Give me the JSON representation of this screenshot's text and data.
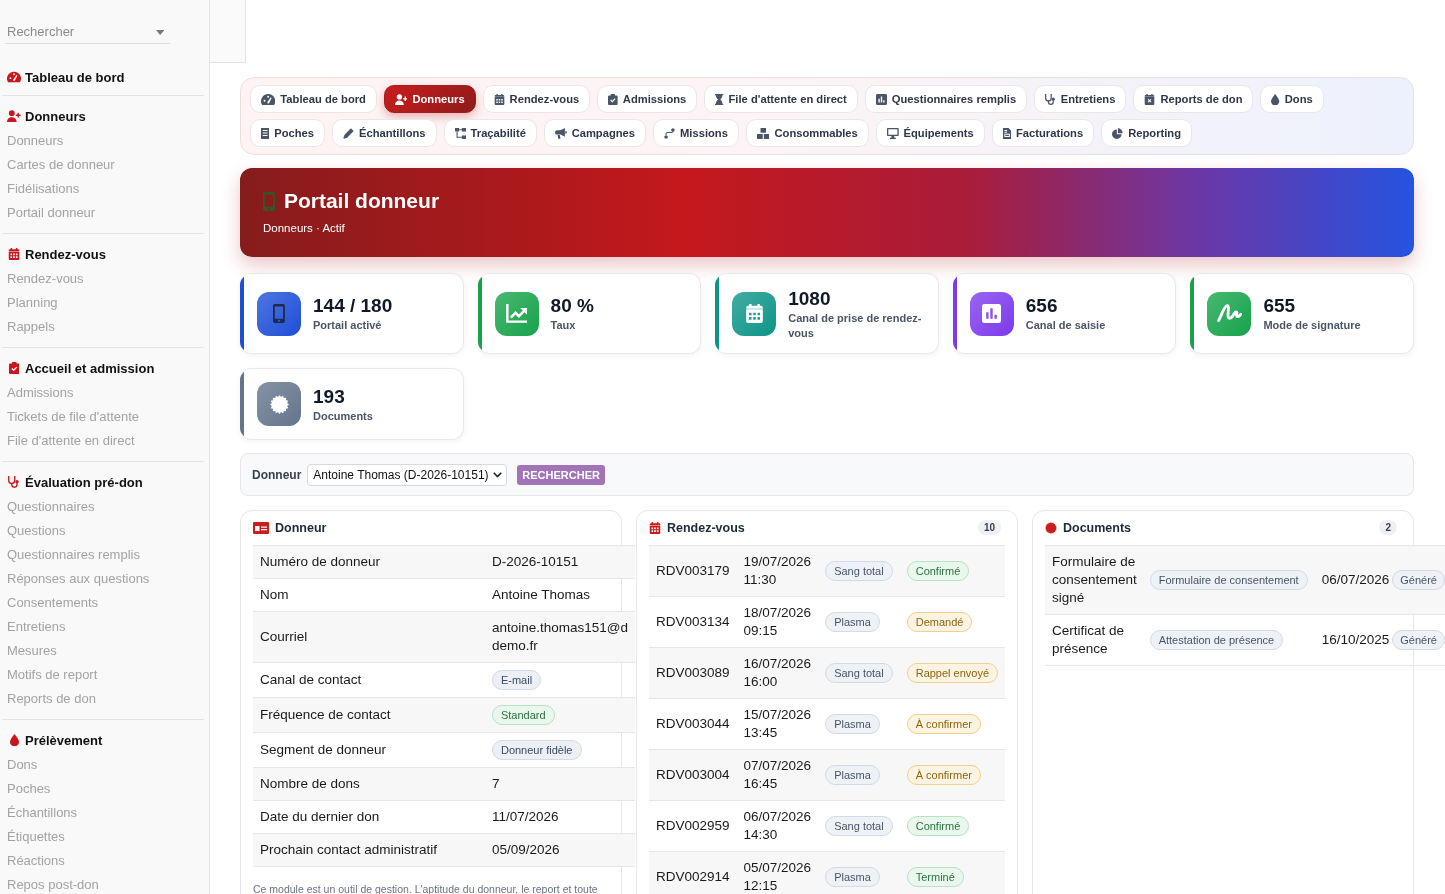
{
  "sidebar": {
    "search": {
      "placeholder": "Rechercher"
    },
    "sections": [
      {
        "title": "Tableau de bord"
      },
      {
        "title": "Donneurs",
        "items": [
          "Donneurs",
          "Cartes de donneur",
          "Fidélisations",
          "Portail donneur"
        ]
      },
      {
        "title": "Rendez-vous",
        "items": [
          "Rendez-vous",
          "Planning",
          "Rappels"
        ]
      },
      {
        "title": "Accueil et admission",
        "items": [
          "Admissions",
          "Tickets de file d'attente",
          "File d'attente en direct"
        ]
      },
      {
        "title": "Évaluation pré-don",
        "items": [
          "Questionnaires",
          "Questions",
          "Questionnaires remplis",
          "Réponses aux questions",
          "Consentements",
          "Entretiens",
          "Mesures",
          "Motifs de report",
          "Reports de don"
        ]
      },
      {
        "title": "Prélèvement",
        "items": [
          "Dons",
          "Poches",
          "Échantillons",
          "Étiquettes",
          "Réactions",
          "Repos post-don"
        ]
      }
    ]
  },
  "tabs": [
    {
      "label": "Tableau de bord",
      "selected": false
    },
    {
      "label": "Donneurs",
      "selected": true
    },
    {
      "label": "Rendez-vous",
      "selected": false
    },
    {
      "label": "Admissions",
      "selected": false
    },
    {
      "label": "File d'attente en direct",
      "selected": false
    },
    {
      "label": "Questionnaires remplis",
      "selected": false
    },
    {
      "label": "Entretiens",
      "selected": false
    },
    {
      "label": "Reports de don",
      "selected": false
    },
    {
      "label": "Dons",
      "selected": false
    },
    {
      "label": "Poches",
      "selected": false
    },
    {
      "label": "Échantillons",
      "selected": false
    },
    {
      "label": "Traçabilité",
      "selected": false
    },
    {
      "label": "Campagnes",
      "selected": false
    },
    {
      "label": "Missions",
      "selected": false
    },
    {
      "label": "Consommables",
      "selected": false
    },
    {
      "label": "Équipements",
      "selected": false
    },
    {
      "label": "Facturations",
      "selected": false
    },
    {
      "label": "Reporting",
      "selected": false
    }
  ],
  "header": {
    "title": "Portail donneur",
    "subtitle": "Donneurs · Actif"
  },
  "stats": [
    {
      "value": "144 / 180",
      "label": "Portail activé",
      "color": "#1d4ed8"
    },
    {
      "value": "80 %",
      "label": "Taux",
      "color": "#16a34a"
    },
    {
      "value": "1080",
      "label": "Canal de prise de rendez-vous",
      "color": "#0d9488"
    },
    {
      "value": "656",
      "label": "Canal de saisie",
      "color": "#7c3aed"
    },
    {
      "value": "655",
      "label": "Mode de signature",
      "color": "#16a34a"
    },
    {
      "value": "193",
      "label": "Documents",
      "color": "#64748b"
    }
  ],
  "donor_search": {
    "label": "Donneur",
    "value": "Antoine Thomas (D-2026-10151)",
    "button": "RECHERCHER"
  },
  "donor_panel": {
    "title": "Donneur",
    "rows": [
      {
        "kind": "text",
        "label": "Numéro de donneur",
        "value": "D-2026-10151"
      },
      {
        "kind": "text",
        "label": "Nom",
        "value": "Antoine Thomas"
      },
      {
        "kind": "text",
        "label": "Courriel",
        "value": "antoine.thomas151@d\ndemo.fr"
      },
      {
        "kind": "badge",
        "label": "Canal de contact",
        "value": "E-mail",
        "color": "#d3dae5"
      },
      {
        "kind": "badge",
        "label": "Fréquence de contact",
        "value": "Standard",
        "color": "#b5e3c3"
      },
      {
        "kind": "badge",
        "label": "Segment de donneur",
        "value": "Donneur fidèle",
        "color": "#d3dae5"
      },
      {
        "kind": "text",
        "label": "Nombre de dons",
        "value": "7"
      },
      {
        "kind": "text",
        "label": "Date du dernier don",
        "value": "11/07/2026"
      },
      {
        "kind": "text",
        "label": "Prochain contact administratif",
        "value": "05/09/2026"
      }
    ],
    "note": "Ce module est un outil de gestion. L'aptitude du donneur, le report et toute"
  },
  "appointments_panel": {
    "title": "Rendez-vous",
    "count": "10",
    "rows": [
      {
        "id": "RDV003179",
        "date": "19/07/2026",
        "time": "11:30",
        "type": "Sang total",
        "status": {
          "text": "Confirmé",
          "color": "#b5e3c3"
        }
      },
      {
        "id": "RDV003134",
        "date": "18/07/2026",
        "time": "09:15",
        "type": "Plasma",
        "status": {
          "text": "Demandé",
          "color": "#f4cf8a"
        }
      },
      {
        "id": "RDV003089",
        "date": "16/07/2026",
        "time": "16:00",
        "type": "Sang total",
        "status": {
          "text": "Rappel envoyé",
          "color": "#f4cf8a"
        }
      },
      {
        "id": "RDV003044",
        "date": "15/07/2026",
        "time": "13:45",
        "type": "Plasma",
        "status": {
          "text": "À confirmer",
          "color": "#f4cf8a"
        }
      },
      {
        "id": "RDV003004",
        "date": "07/07/2026",
        "time": "16:45",
        "type": "Plasma",
        "status": {
          "text": "À confirmer",
          "color": "#f4cf8a"
        }
      },
      {
        "id": "RDV002959",
        "date": "06/07/2026",
        "time": "14:30",
        "type": "Sang total",
        "status": {
          "text": "Confirmé",
          "color": "#b5e3c3"
        }
      },
      {
        "id": "RDV002914",
        "date": "05/07/2026",
        "time": "12:15",
        "type": "Plasma",
        "status": {
          "text": "Terminé",
          "color": "#b5e3c3"
        }
      }
    ]
  },
  "documents_panel": {
    "title": "Documents",
    "count": "2",
    "rows": [
      {
        "name": "Formulaire de consentement signé",
        "category": "Formulaire de consentement",
        "date": "06/07/2026",
        "status": "Généré"
      },
      {
        "name": "Certificat de présence",
        "category": "Attestation de présence",
        "date": "16/10/2025",
        "status": "Généré"
      }
    ]
  }
}
